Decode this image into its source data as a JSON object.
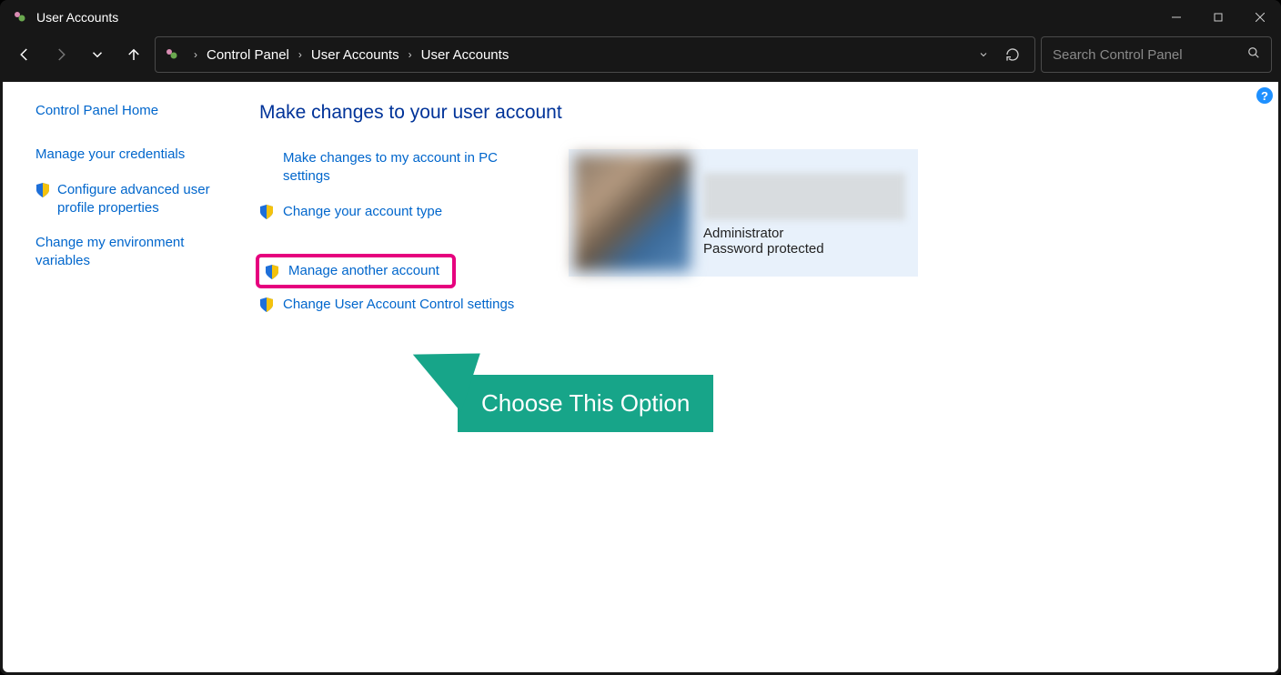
{
  "window": {
    "title": "User Accounts"
  },
  "breadcrumb": {
    "items": [
      "Control Panel",
      "User Accounts",
      "User Accounts"
    ]
  },
  "search": {
    "placeholder": "Search Control Panel"
  },
  "sidebar": {
    "home": "Control Panel Home",
    "items": [
      {
        "label": "Manage your credentials",
        "shield": false
      },
      {
        "label": "Configure advanced user profile properties",
        "shield": true
      },
      {
        "label": "Change my environment variables",
        "shield": false
      }
    ]
  },
  "main": {
    "heading": "Make changes to your user account",
    "links": {
      "pc_settings": "Make changes to my account in PC settings",
      "change_type": "Change your account type",
      "manage_another": "Manage another account",
      "uac_settings": "Change User Account Control settings"
    },
    "account": {
      "role": "Administrator",
      "protection": "Password protected"
    }
  },
  "callout": {
    "text": "Choose This Option"
  }
}
